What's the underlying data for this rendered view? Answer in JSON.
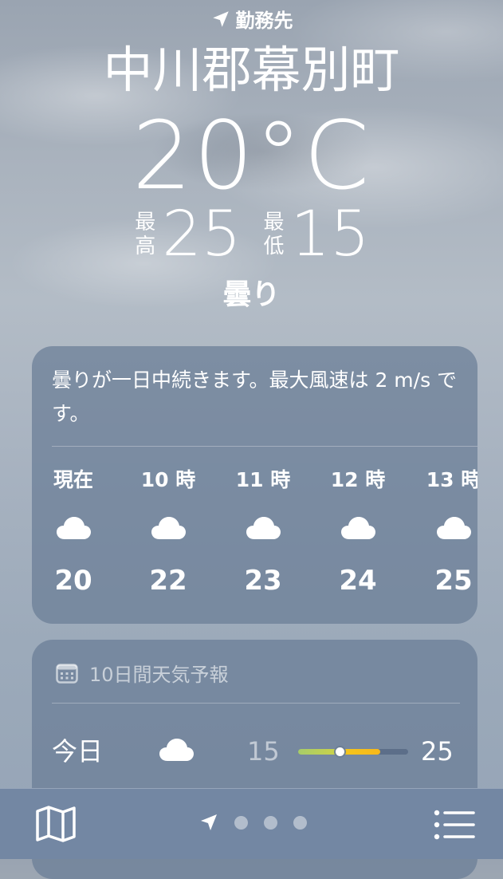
{
  "header": {
    "location_label": "勤務先",
    "city": "中川郡幕別町",
    "temperature": "20°C",
    "high_label": "最高",
    "high": "25",
    "low_label": "最低",
    "low": "15",
    "condition": "曇り"
  },
  "hourly_card": {
    "summary": "曇りが一日中続きます。最大風速は 2 m/s です。",
    "hours": [
      {
        "label": "現在",
        "icon": "cloud-icon",
        "temp": "20"
      },
      {
        "label": "10 時",
        "icon": "cloud-icon",
        "temp": "22"
      },
      {
        "label": "11 時",
        "icon": "cloud-icon",
        "temp": "23"
      },
      {
        "label": "12 時",
        "icon": "cloud-icon",
        "temp": "24"
      },
      {
        "label": "13 時",
        "icon": "cloud-icon",
        "temp": "25"
      }
    ]
  },
  "forecast_card": {
    "title": "10日間天気予報",
    "icon": "calendar-icon",
    "days": [
      {
        "day": "今日",
        "icon": "cloud-icon",
        "low": "15",
        "high": "25",
        "current_marker_fraction": 0.5
      }
    ]
  },
  "bottom_bar": {
    "map_icon": "map-icon",
    "location_icon": "location-arrow-icon",
    "page_count": 4,
    "list_icon": "list-icon"
  },
  "colors": {
    "card_bg": "#6a7f9c",
    "bottom_bar": "#7387a3",
    "temp_bar_cool": "#a7cc6a",
    "temp_bar_warm": "#f7b81a"
  }
}
